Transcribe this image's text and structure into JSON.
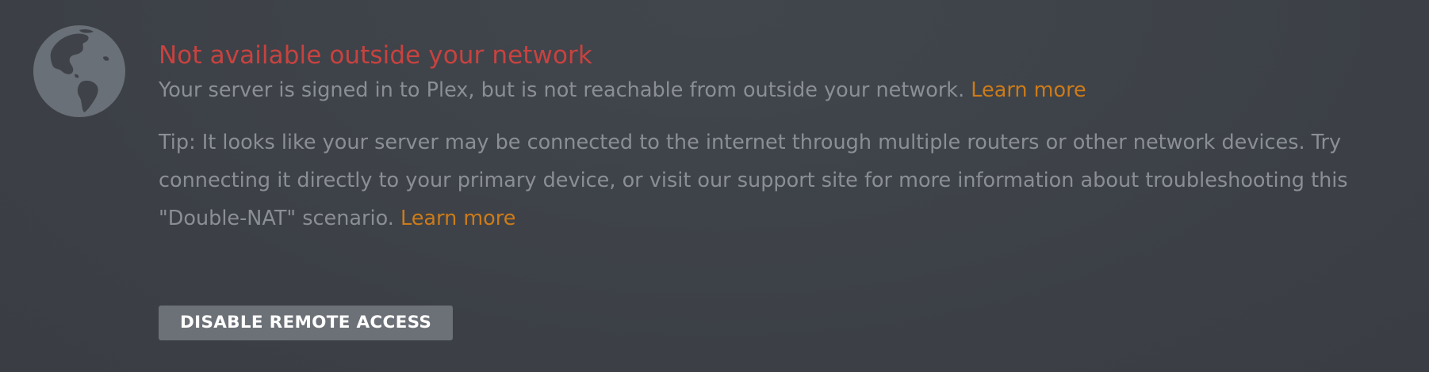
{
  "colors": {
    "background": "#3f4349",
    "globe": "#6a7077",
    "globe_land": "#3f4349",
    "title": "#c8423f",
    "body_text": "#8b8f95",
    "link": "#cc7b19",
    "button_bg": "#6c7077",
    "button_text": "#ffffff"
  },
  "status": {
    "icon": "globe-icon",
    "title": "Not available outside your network",
    "description": "Your server is signed in to Plex, but is not reachable from outside your network.",
    "learn_more_label": "Learn more"
  },
  "tip": {
    "text": "Tip: It looks like your server may be connected to the internet through multiple routers or other network devices. Try connecting it directly to your primary device, or visit our support site for more information about troubleshooting this \"Double-NAT\" scenario.",
    "learn_more_label": "Learn more"
  },
  "actions": {
    "disable_remote_access_label": "DISABLE REMOTE ACCESS"
  }
}
